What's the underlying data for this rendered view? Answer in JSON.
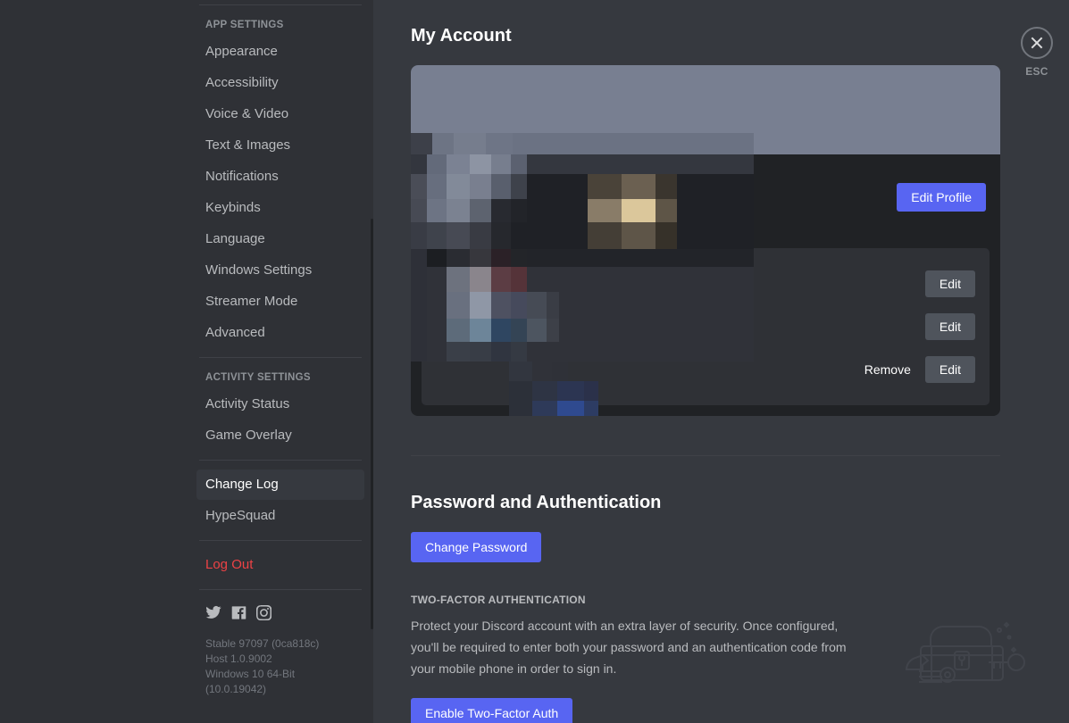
{
  "colors": {
    "blurple": "#5865F2",
    "danger_red": "#ED4245",
    "sidebar_bg": "#2F3136",
    "content_bg": "#36393F",
    "card_bg": "#202225",
    "inner_panel_bg": "#2F3136",
    "secondary_btn": "#4F545C",
    "banner": "#787F91",
    "muted_text": "#B9BBBE",
    "dim_text": "#72767D"
  },
  "sidebar": {
    "sections": [
      {
        "header": "APP SETTINGS",
        "items": [
          {
            "label": "Appearance",
            "active": false
          },
          {
            "label": "Accessibility",
            "active": false
          },
          {
            "label": "Voice & Video",
            "active": false
          },
          {
            "label": "Text & Images",
            "active": false
          },
          {
            "label": "Notifications",
            "active": false
          },
          {
            "label": "Keybinds",
            "active": false
          },
          {
            "label": "Language",
            "active": false
          },
          {
            "label": "Windows Settings",
            "active": false
          },
          {
            "label": "Streamer Mode",
            "active": false
          },
          {
            "label": "Advanced",
            "active": false
          }
        ]
      },
      {
        "header": "ACTIVITY SETTINGS",
        "items": [
          {
            "label": "Activity Status",
            "active": false
          },
          {
            "label": "Game Overlay",
            "active": false
          }
        ]
      },
      {
        "header": "",
        "items": [
          {
            "label": "Change Log",
            "active": true
          },
          {
            "label": "HypeSquad",
            "active": false
          }
        ]
      }
    ],
    "logout_label": "Log Out",
    "socials": [
      {
        "name": "twitter-icon"
      },
      {
        "name": "facebook-icon"
      },
      {
        "name": "instagram-icon"
      }
    ],
    "version_lines": [
      "Stable 97097 (0ca818c)",
      "Host 1.0.9002",
      "Windows 10 64-Bit (10.0.19042)"
    ]
  },
  "main": {
    "page_title": "My Account",
    "account_card": {
      "edit_profile_label": "Edit Profile",
      "rows": [
        {
          "edit_label": "Edit",
          "remove_label": ""
        },
        {
          "edit_label": "Edit",
          "remove_label": ""
        },
        {
          "edit_label": "Edit",
          "remove_label": "Remove"
        }
      ]
    },
    "password_section": {
      "title": "Password and Authentication",
      "change_password_label": "Change Password",
      "twofa_subhead": "TWO-FACTOR AUTHENTICATION",
      "twofa_description": "Protect your Discord account with an extra layer of security. Once configured, you'll be required to enter both your password and an authentication code from your mobile phone in order to sign in.",
      "enable_twofa_label": "Enable Two-Factor Auth"
    }
  },
  "close_button": {
    "label": "ESC",
    "icon": "close-icon"
  }
}
